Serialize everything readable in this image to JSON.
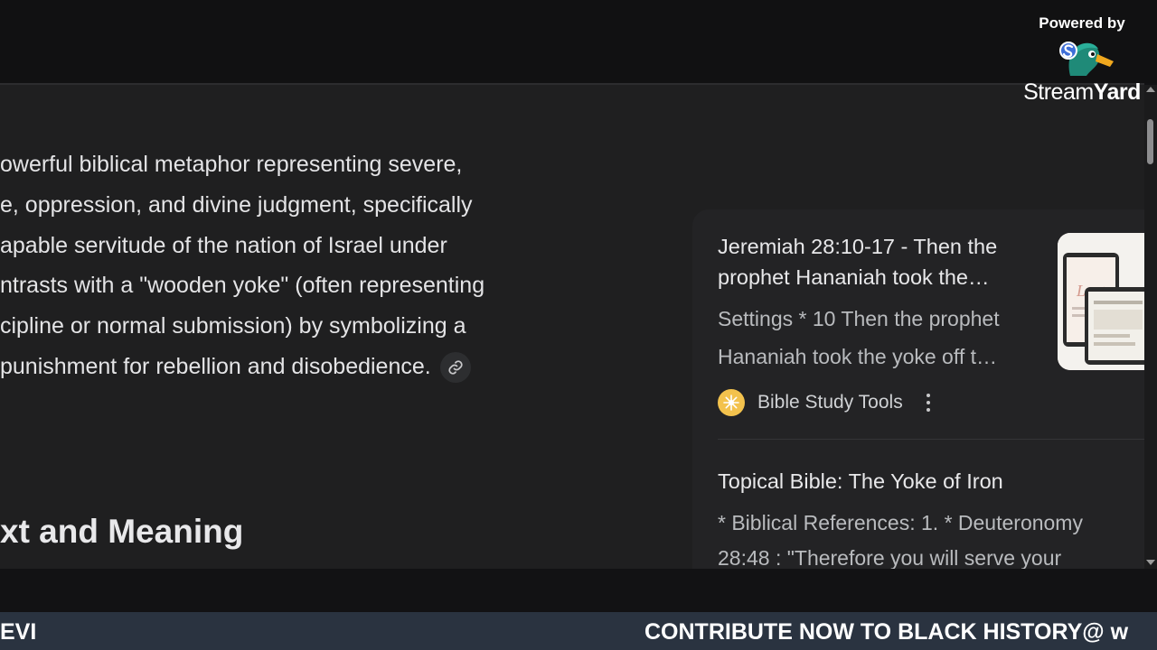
{
  "answer": {
    "lines": [
      "owerful biblical metaphor representing severe,",
      "e, oppression, and divine judgment, specifically",
      "apable servitude of the nation of Israel under",
      "ntrasts with a \"wooden yoke\" (often representing",
      "cipline or normal submission) by symbolizing a",
      " punishment for rebellion and disobedience."
    ],
    "link_icon": "link-icon",
    "section_heading": "xt and Meaning"
  },
  "sources": [
    {
      "title": "Jeremiah 28:10-17 - Then the prophet Hananiah took the…",
      "snippet": "Settings * 10 Then the prophet Hananiah took the yoke off t…",
      "site": "Bible Study Tools",
      "favicon": "sun-icon",
      "thumbnail_text": "Lent"
    },
    {
      "title": "Topical Bible: The Yoke of Iron",
      "snippet_line1": "* Biblical References: 1. * Deuteronomy",
      "snippet_line2": "28:48 : \"Therefore you will serve your"
    }
  ],
  "overlay": {
    "powered_label": "Powered by",
    "brand_light": "Stream",
    "brand_bold": "Yard"
  },
  "ticker": {
    "left_text": "EVI",
    "right_text": "CONTRIBUTE NOW TO BLACK HISTORY@ w"
  },
  "colors": {
    "page_bg": "#1f1f20",
    "panel_bg": "#232325",
    "ticker_bg": "#2a3340",
    "favicon": "#f3c24d"
  }
}
